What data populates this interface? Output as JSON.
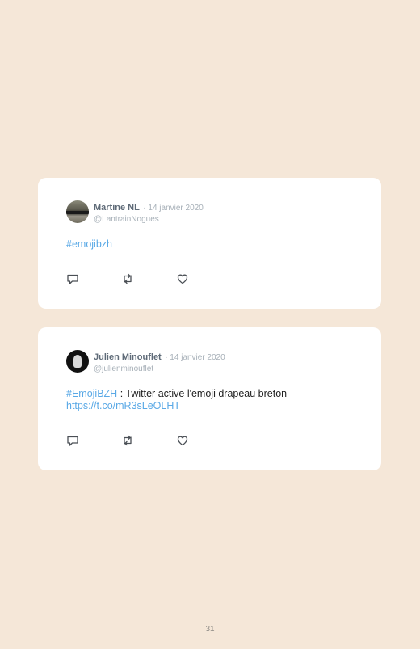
{
  "tweets": [
    {
      "name": "Martine NL",
      "date": "· 14 janvier 2020",
      "handle": "@LantrainNogues",
      "hashtag": "#emojibzh",
      "text": "",
      "url": ""
    },
    {
      "name": "Julien Minouflet",
      "date": "· 14 janvier 2020",
      "handle": "@julienminouflet",
      "hashtag": "#EmojiBZH",
      "text": " : Twitter active l'emoji drapeau breton",
      "url": "https://t.co/mR3sLeOLHT"
    }
  ],
  "icons": {
    "reply": "reply-icon",
    "retweet": "retweet-icon",
    "like": "heart-icon"
  },
  "colors": {
    "background": "#f5e7d8",
    "card": "#ffffff",
    "link": "#5aa9e6",
    "name": "#5f6b78",
    "muted": "#a7b0b8"
  },
  "page_number": "31"
}
